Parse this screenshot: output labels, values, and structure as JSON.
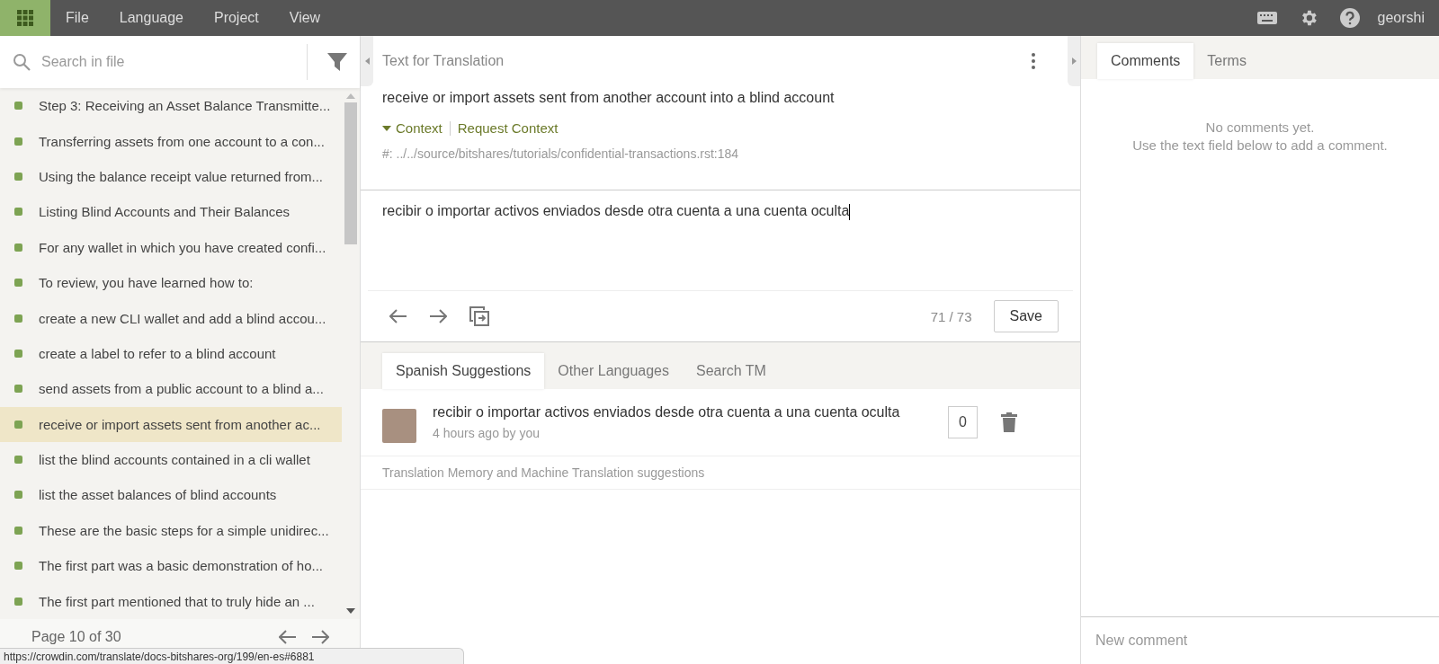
{
  "menu": [
    "File",
    "Language",
    "Project",
    "View"
  ],
  "user": "georshi",
  "sidebar": {
    "search": {
      "placeholder": "Search in file"
    },
    "strings": [
      {
        "text": "Step 3: Receiving an Asset Balance Transmitte...",
        "selected": false
      },
      {
        "text": "Transferring assets from one account to a con...",
        "selected": false
      },
      {
        "text": "Using the balance receipt value returned from...",
        "selected": false
      },
      {
        "text": "Listing Blind Accounts and Their Balances",
        "selected": false
      },
      {
        "text": "For any wallet in which you have created confi...",
        "selected": false
      },
      {
        "text": "To review, you have learned how to:",
        "selected": false
      },
      {
        "text": "create a new CLI wallet and add a blind accou...",
        "selected": false
      },
      {
        "text": "create a label to refer to a blind account",
        "selected": false
      },
      {
        "text": "send assets from a public account to a blind a...",
        "selected": false
      },
      {
        "text": "receive or import assets sent from another ac...",
        "selected": true
      },
      {
        "text": "list the blind accounts contained in a cli wallet",
        "selected": false
      },
      {
        "text": "list the asset balances of blind accounts",
        "selected": false
      },
      {
        "text": "These are the basic steps for a simple unidirec...",
        "selected": false
      },
      {
        "text": "The first part was a basic demonstration of ho...",
        "selected": false
      },
      {
        "text": "The first part mentioned that to truly hide an ...",
        "selected": false
      }
    ],
    "page": "Page 10 of 30"
  },
  "status_url": "https://crowdin.com/translate/docs-bitshares-org/199/en-es#6881",
  "editor": {
    "title": "Text for Translation",
    "source": "receive or import assets sent from another account into a blind account",
    "context": {
      "label": "Context",
      "expanded": true
    },
    "request_context": "Request Context",
    "path": "#: ../../source/bitshares/tutorials/confidential-transactions.rst:184",
    "translation": "recibir o importar activos enviados desde otra cuenta a una cuenta oculta",
    "counter": "71 / 73",
    "save": "Save"
  },
  "suggestions": {
    "tabs": [
      {
        "label": "Spanish Suggestions",
        "selected": true
      },
      {
        "label": "Other Languages",
        "selected": false
      },
      {
        "label": "Search TM",
        "selected": false
      }
    ],
    "items": [
      {
        "text": "recibir o importar activos enviados desde otra cuenta a una cuenta oculta",
        "meta": "4 hours ago by you",
        "votes": "0"
      }
    ],
    "tm_note": "Translation Memory and Machine Translation suggestions"
  },
  "comments": {
    "tabs": [
      {
        "label": "Comments",
        "selected": true
      },
      {
        "label": "Terms",
        "selected": false
      }
    ],
    "empty": [
      "No comments yet.",
      "Use the text field below to add a comment."
    ],
    "placeholder": "New comment"
  }
}
